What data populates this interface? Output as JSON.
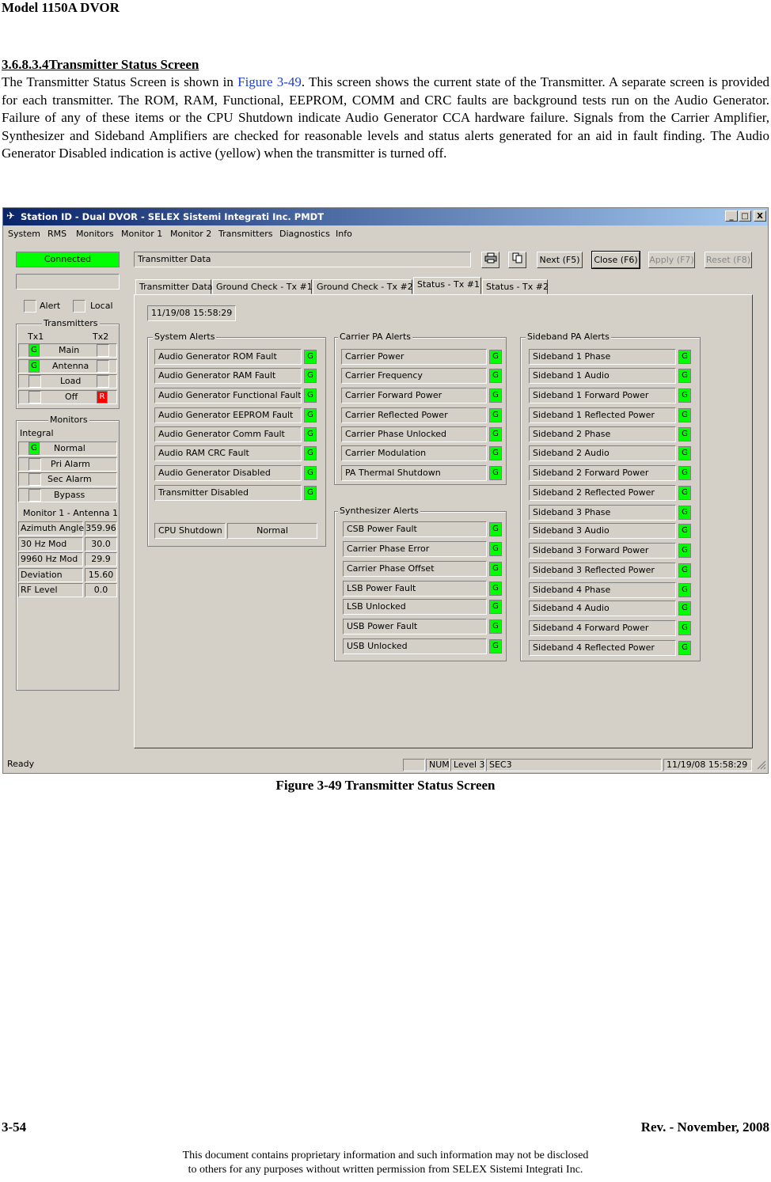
{
  "document": {
    "header": "Model 1150A DVOR",
    "section_number": "3.6.8.3.4",
    "section_title": "Transmitter Status Screen",
    "body_before_ref": "The Transmitter Status Screen is shown in ",
    "figure_ref": "Figure 3-49",
    "body_after_ref": ".  This screen shows the current state of the Transmitter. A separate screen is provided for each transmitter. The ROM, RAM, Functional, EEPROM, COMM and CRC faults are background tests run on the Audio Generator. Failure of any of these items or the CPU Shutdown indicate Audio Generator CCA hardware failure. Signals from the Carrier Amplifier, Synthesizer and Sideband Amplifiers are checked for reasonable levels and status alerts generated for an aid in fault finding. The Audio Generator Disabled indication is active (yellow) when the transmitter is turned off.",
    "caption": "Figure 3-49  Transmitter Status Screen",
    "page_number": "3-54",
    "revision": "Rev. -  November, 2008",
    "footer_line1": "This document contains proprietary information and such information may not be disclosed",
    "footer_line2": "to others for any purposes without written permission from SELEX Sistemi Integrati Inc."
  },
  "window": {
    "title": "Station ID - Dual DVOR - SELEX Sistemi Integrati Inc. PMDT",
    "title_buttons": [
      "_",
      "□",
      "X"
    ],
    "menu": [
      "System",
      "RMS",
      "Monitors",
      "Monitor 1",
      "Monitor 2",
      "Transmitters",
      "Diagnostics",
      "Info"
    ],
    "connected": "Connected",
    "transmitter_data_field": "Transmitter Data",
    "toolbar": {
      "print_icon": "printer-icon",
      "copy_icon": "copy-icon",
      "next": "Next (F5)",
      "close": "Close (F6)",
      "apply": "Apply (F7)",
      "reset": "Reset (F8)"
    },
    "left_panel": {
      "alert": "Alert",
      "local": "Local",
      "transmitters_title": "Transmitters",
      "tx1": "Tx1",
      "tx2": "Tx2",
      "tx_rows": [
        {
          "label": "Main",
          "tx1": "G",
          "tx2": ""
        },
        {
          "label": "Antenna",
          "tx1": "G",
          "tx2": ""
        },
        {
          "label": "Load",
          "tx1": "",
          "tx2": ""
        },
        {
          "label": "Off",
          "tx1": "",
          "tx2": "R"
        }
      ],
      "monitors_title": "Monitors",
      "integral": "Integral",
      "monitor_rows": [
        {
          "label": "Normal",
          "ind": "G"
        },
        {
          "label": "Pri Alarm",
          "ind": ""
        },
        {
          "label": "Sec Alarm",
          "ind": ""
        },
        {
          "label": "Bypass",
          "ind": ""
        }
      ],
      "monitor_antenna": "Monitor 1 - Antenna 1",
      "readings": [
        {
          "label": "Azimuth Angle",
          "value": "359.96"
        },
        {
          "label": "30 Hz Mod",
          "value": "30.0"
        },
        {
          "label": "9960 Hz Mod",
          "value": "29.9"
        },
        {
          "label": "Deviation",
          "value": "15.60"
        },
        {
          "label": "RF Level",
          "value": "0.0"
        }
      ]
    },
    "tabs": [
      "Transmitter Data",
      "Ground Check - Tx #1",
      "Ground Check - Tx #2",
      "Status - Tx #1",
      "Status - Tx #2"
    ],
    "active_tab": "Status - Tx #1",
    "timestamp": "11/19/08 15:58:29",
    "system_alerts": {
      "title": "System Alerts",
      "items": [
        {
          "label": "Audio Generator ROM Fault",
          "status": "G"
        },
        {
          "label": "Audio Generator RAM Fault",
          "status": "G"
        },
        {
          "label": "Audio Generator Functional Fault",
          "status": "G"
        },
        {
          "label": "Audio Generator EEPROM Fault",
          "status": "G"
        },
        {
          "label": "Audio Generator Comm Fault",
          "status": "G"
        },
        {
          "label": "Audio RAM CRC Fault",
          "status": "G"
        },
        {
          "label": "Audio Generator Disabled",
          "status": "G"
        },
        {
          "label": "Transmitter Disabled",
          "status": "G"
        }
      ],
      "cpu_label": "CPU Shutdown",
      "cpu_value": "Normal"
    },
    "carrier_pa_alerts": {
      "title": "Carrier PA Alerts",
      "items": [
        {
          "label": "Carrier Power",
          "status": "G"
        },
        {
          "label": "Carrier Frequency",
          "status": "G"
        },
        {
          "label": "Carrier Forward Power",
          "status": "G"
        },
        {
          "label": "Carrier Reflected Power",
          "status": "G"
        },
        {
          "label": "Carrier Phase Unlocked",
          "status": "G"
        },
        {
          "label": "Carrier Modulation",
          "status": "G"
        },
        {
          "label": "PA Thermal Shutdown",
          "status": "G"
        }
      ]
    },
    "synthesizer_alerts": {
      "title": "Synthesizer Alerts",
      "items": [
        {
          "label": "CSB Power Fault",
          "status": "G"
        },
        {
          "label": "Carrier Phase Error",
          "status": "G"
        },
        {
          "label": "Carrier Phase Offset",
          "status": "G"
        },
        {
          "label": "LSB Power Fault",
          "status": "G"
        },
        {
          "label": "LSB Unlocked",
          "status": "G"
        },
        {
          "label": "USB Power Fault",
          "status": "G"
        },
        {
          "label": "USB Unlocked",
          "status": "G"
        }
      ]
    },
    "sideband_pa_alerts": {
      "title": "Sideband PA Alerts",
      "items": [
        {
          "label": "Sideband 1 Phase",
          "status": "G"
        },
        {
          "label": "Sideband 1 Audio",
          "status": "G"
        },
        {
          "label": "Sideband 1 Forward Power",
          "status": "G"
        },
        {
          "label": "Sideband 1 Reflected Power",
          "status": "G"
        },
        {
          "label": "Sideband 2 Phase",
          "status": "G"
        },
        {
          "label": "Sideband 2 Audio",
          "status": "G"
        },
        {
          "label": "Sideband 2 Forward Power",
          "status": "G"
        },
        {
          "label": "Sideband 2 Reflected Power",
          "status": "G"
        },
        {
          "label": "Sideband 3 Phase",
          "status": "G"
        },
        {
          "label": "Sideband 3 Audio",
          "status": "G"
        },
        {
          "label": "Sideband 3 Forward Power",
          "status": "G"
        },
        {
          "label": "Sideband 3 Reflected Power",
          "status": "G"
        },
        {
          "label": "Sideband 4 Phase",
          "status": "G"
        },
        {
          "label": "Sideband 4 Audio",
          "status": "G"
        },
        {
          "label": "Sideband 4 Forward Power",
          "status": "G"
        },
        {
          "label": "Sideband 4 Reflected Power",
          "status": "G"
        }
      ]
    },
    "statusbar": {
      "ready": "Ready",
      "num": "NUM",
      "level": "Level 3",
      "sec": "SEC3",
      "time": "11/19/08 15:58:29"
    },
    "colors": {
      "green": "#00ff00",
      "red": "#ff0000",
      "titlebar": "#0a246a",
      "face": "#d4d0c8"
    }
  }
}
